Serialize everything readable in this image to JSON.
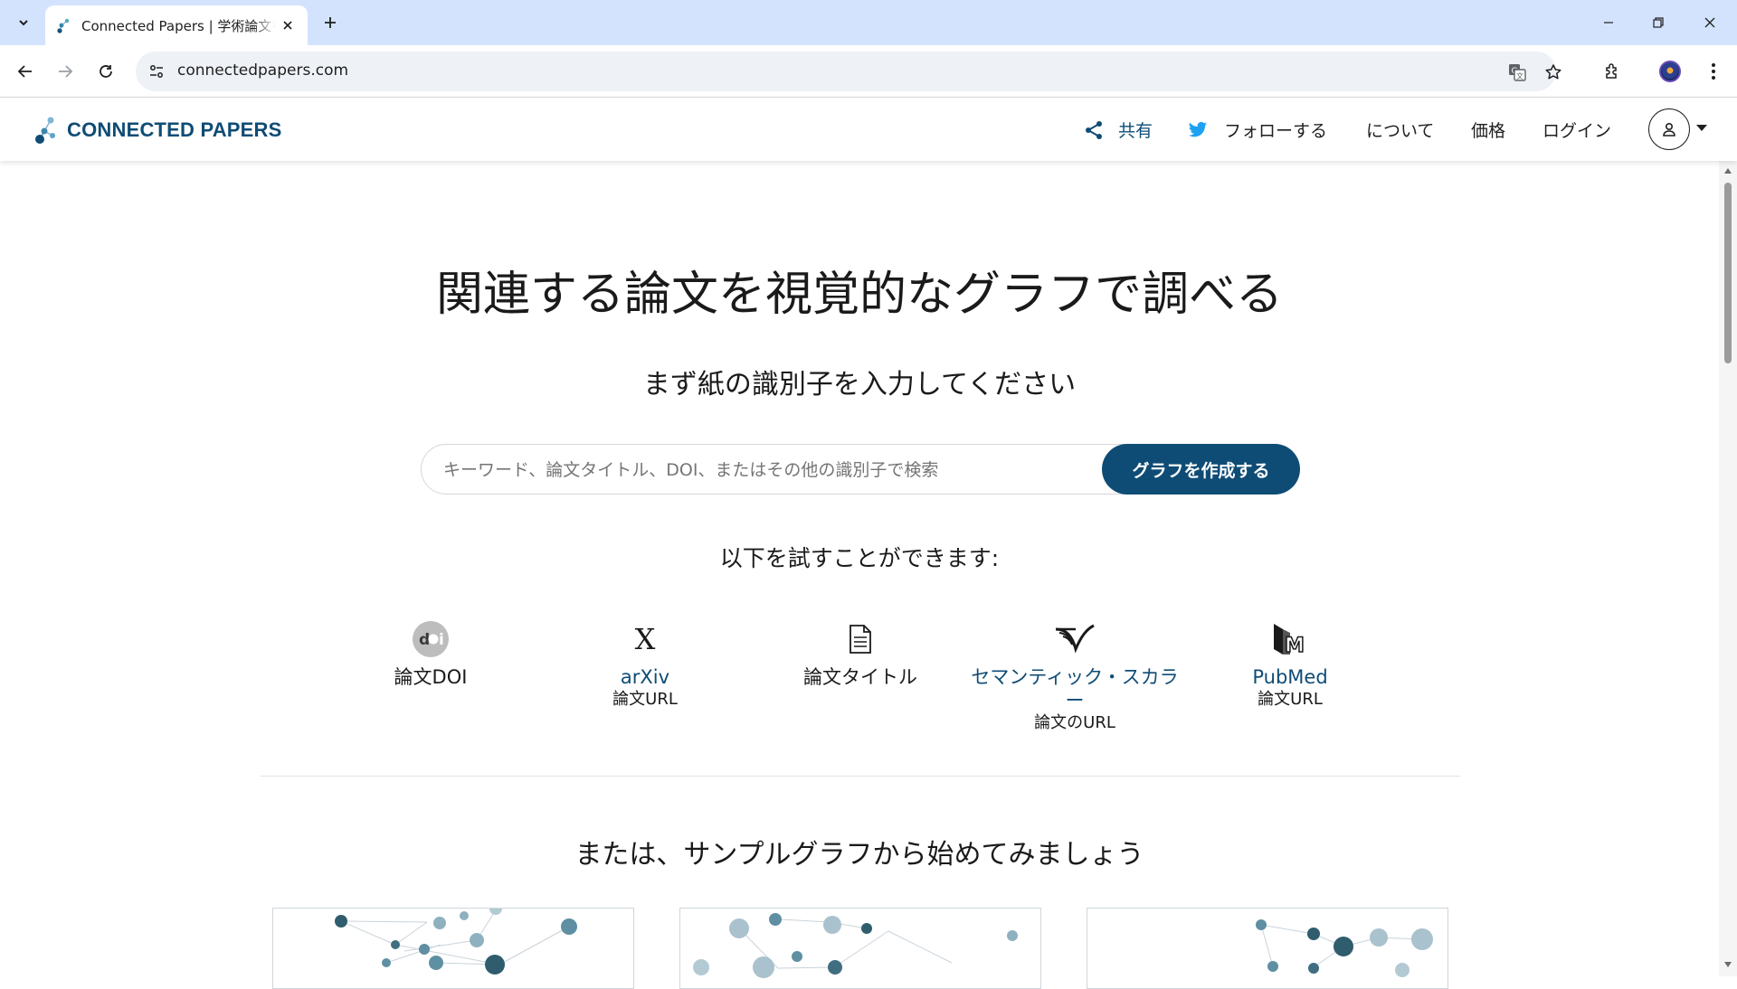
{
  "browser": {
    "tab_title": "Connected Papers | 学術論文を視覚的に調べる",
    "url": "connectedpapers.com"
  },
  "header": {
    "logo_text": "CONNECTED PAPERS",
    "share": "共有",
    "follow": "フォローする",
    "about": "について",
    "pricing": "価格",
    "login": "ログイン"
  },
  "hero": {
    "title": "関連する論文を視覚的なグラフで調べる",
    "subtitle": "まず紙の識別子を入力してください"
  },
  "search": {
    "placeholder": "キーワード、論文タイトル、DOI、またはその他の識別子で検索",
    "button_label": "グラフを作成する"
  },
  "try": {
    "label": "以下を試すことができます:"
  },
  "sources": [
    {
      "icon": "doi-icon",
      "main": "論文DOI",
      "sub": ""
    },
    {
      "icon": "arxiv-icon",
      "main": "arXiv",
      "sub": "論文URL"
    },
    {
      "icon": "document-icon",
      "main": "論文タイトル",
      "sub": ""
    },
    {
      "icon": "semantic-scholar-icon",
      "main": "セマンティック・スカラー",
      "sub": "論文のURL"
    },
    {
      "icon": "pubmed-icon",
      "main": "PubMed",
      "sub": "論文URL"
    }
  ],
  "samples": {
    "title": "または、サンプルグラフから始めてみましょう"
  },
  "colors": {
    "brand": "#0f4c75",
    "chrome_tabbar": "#d3e3fd"
  }
}
